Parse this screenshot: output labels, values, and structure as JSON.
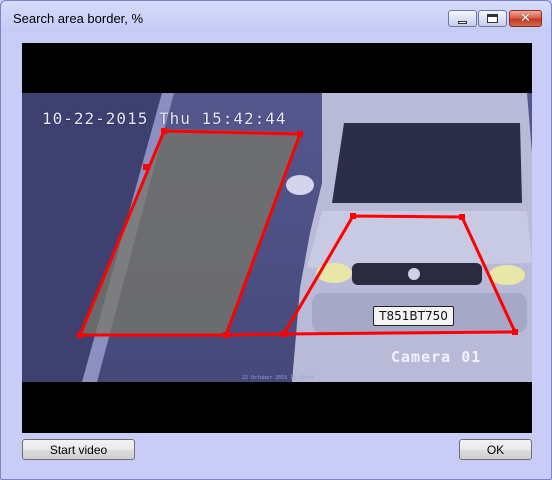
{
  "window": {
    "title": "Search area border, %",
    "controls": {
      "minimize": "minimize",
      "maximize": "maximize",
      "close": "✕"
    }
  },
  "video": {
    "timestamp": "10-22-2015 Thu 15:42:44",
    "camera_label": "Camera 01",
    "plate_text": "T851BT750",
    "footer_caption": "22 October 2015 15:42:44",
    "zone_color": "#ff0000"
  },
  "buttons": {
    "start_video": "Start video",
    "ok": "OK"
  }
}
